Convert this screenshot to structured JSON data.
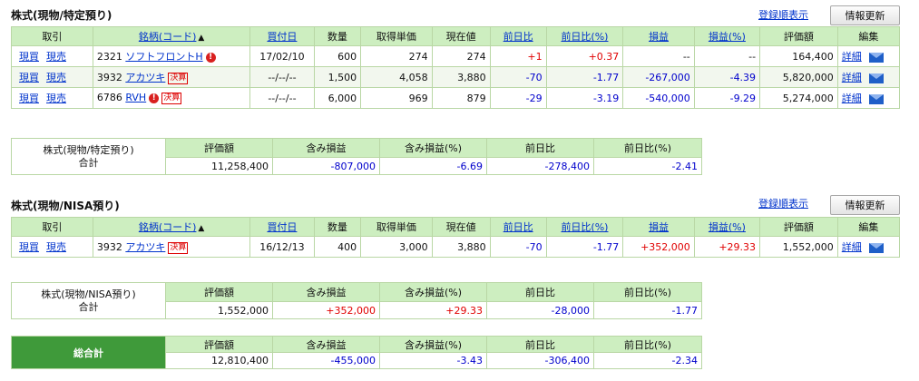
{
  "section1": {
    "title": "株式(現物/特定預り)",
    "sort_link": "登録順表示",
    "refresh_button": "情報更新",
    "headers": {
      "trade": "取引",
      "name": "銘柄(コード)",
      "sort_arrow": "▲",
      "date": "買付日",
      "qty": "数量",
      "cost": "取得単価",
      "price": "現在値",
      "day": "前日比",
      "day_pct": "前日比(%)",
      "pl": "損益",
      "pl_pct": "損益(%)",
      "value": "評価額",
      "edit": "編集"
    },
    "rows": [
      {
        "buy": "現買",
        "sell": "現売",
        "code": "2321",
        "name": "ソフトフロントH",
        "circle": "!",
        "badge": "",
        "date": "17/02/10",
        "qty": "600",
        "cost": "274",
        "price": "274",
        "day": "+1",
        "day_pct": "+0.37",
        "pl": "--",
        "pl_pct": "--",
        "value": "164,400",
        "detail": "詳細"
      },
      {
        "buy": "現買",
        "sell": "現売",
        "code": "3932",
        "name": "アカツキ",
        "circle": "",
        "badge": "決算",
        "date": "--/--/--",
        "qty": "1,500",
        "cost": "4,058",
        "price": "3,880",
        "day": "-70",
        "day_pct": "-1.77",
        "pl": "-267,000",
        "pl_pct": "-4.39",
        "value": "5,820,000",
        "detail": "詳細"
      },
      {
        "buy": "現買",
        "sell": "現売",
        "code": "6786",
        "name": "RVH",
        "circle": "!",
        "badge": "決算",
        "date": "--/--/--",
        "qty": "6,000",
        "cost": "969",
        "price": "879",
        "day": "-29",
        "day_pct": "-3.19",
        "pl": "-540,000",
        "pl_pct": "-9.29",
        "value": "5,274,000",
        "detail": "詳細"
      }
    ],
    "summary": {
      "label_top": "株式(現物/特定預り)",
      "label_bottom": "合計",
      "h_value": "評価額",
      "h_pl": "含み損益",
      "h_pl_pct": "含み損益(%)",
      "h_day": "前日比",
      "h_day_pct": "前日比(%)",
      "value": "11,258,400",
      "pl": "-807,000",
      "pl_pct": "-6.69",
      "day": "-278,400",
      "day_pct": "-2.41"
    }
  },
  "section2": {
    "title": "株式(現物/NISA預り)",
    "sort_link": "登録順表示",
    "refresh_button": "情報更新",
    "rows": [
      {
        "buy": "現買",
        "sell": "現売",
        "code": "3932",
        "name": "アカツキ",
        "badge": "決算",
        "date": "16/12/13",
        "qty": "400",
        "cost": "3,000",
        "price": "3,880",
        "day": "-70",
        "day_pct": "-1.77",
        "pl": "+352,000",
        "pl_pct": "+29.33",
        "value": "1,552,000",
        "detail": "詳細"
      }
    ],
    "summary": {
      "label_top": "株式(現物/NISA預り)",
      "label_bottom": "合計",
      "value": "1,552,000",
      "pl": "+352,000",
      "pl_pct": "+29.33",
      "day": "-28,000",
      "day_pct": "-1.77"
    }
  },
  "grand_total": {
    "label": "総合計",
    "value": "12,810,400",
    "pl": "-455,000",
    "pl_pct": "-3.43",
    "day": "-306,400",
    "day_pct": "-2.34"
  },
  "colors": {
    "header_bg": "#cdeec0",
    "grid": "#b9d7a5",
    "positive": "#e00000",
    "negative": "#0000cc",
    "link": "#0033cc",
    "total_label_bg": "#3f9a3a"
  }
}
